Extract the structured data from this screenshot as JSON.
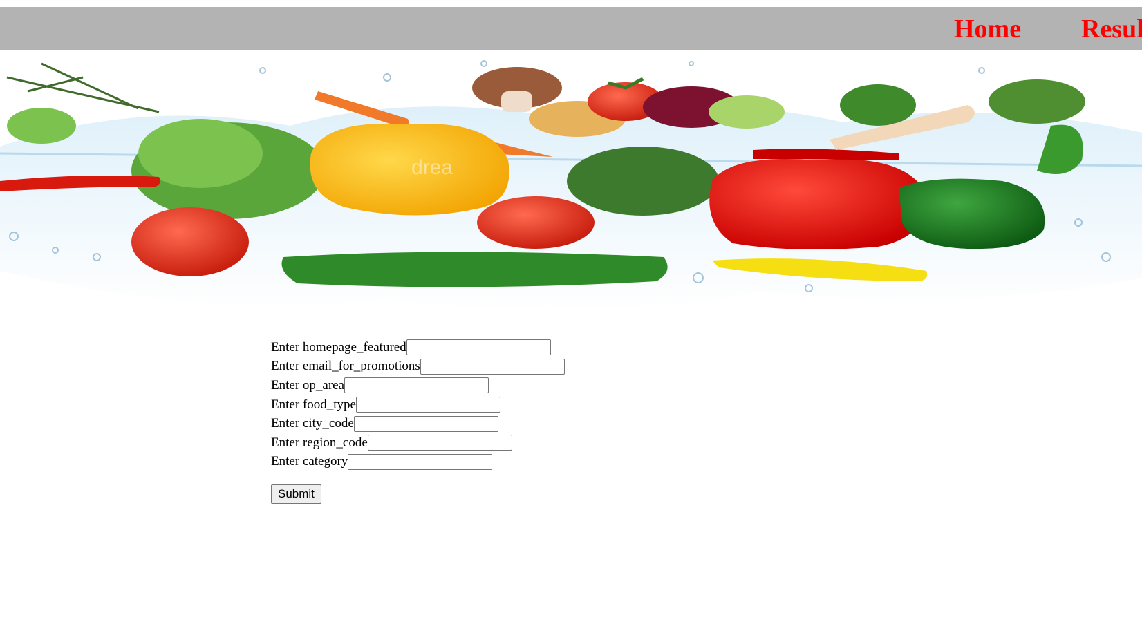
{
  "nav": {
    "home_label": "Home",
    "results_label": "Results",
    "background_color": "#b3b3b3",
    "link_color": "#ff0000"
  },
  "banner": {
    "image_description_icon": "vegetables-water-splash-image",
    "watermark_text": "drea"
  },
  "form": {
    "fields": [
      {
        "label": "Enter homepage_featured",
        "value": ""
      },
      {
        "label": "Enter email_for_promotions",
        "value": ""
      },
      {
        "label": "Enter op_area",
        "value": ""
      },
      {
        "label": "Enter food_type",
        "value": ""
      },
      {
        "label": "Enter city_code",
        "value": ""
      },
      {
        "label": "Enter region_code",
        "value": ""
      },
      {
        "label": "Enter category",
        "value": ""
      }
    ],
    "submit_label": "Submit"
  }
}
